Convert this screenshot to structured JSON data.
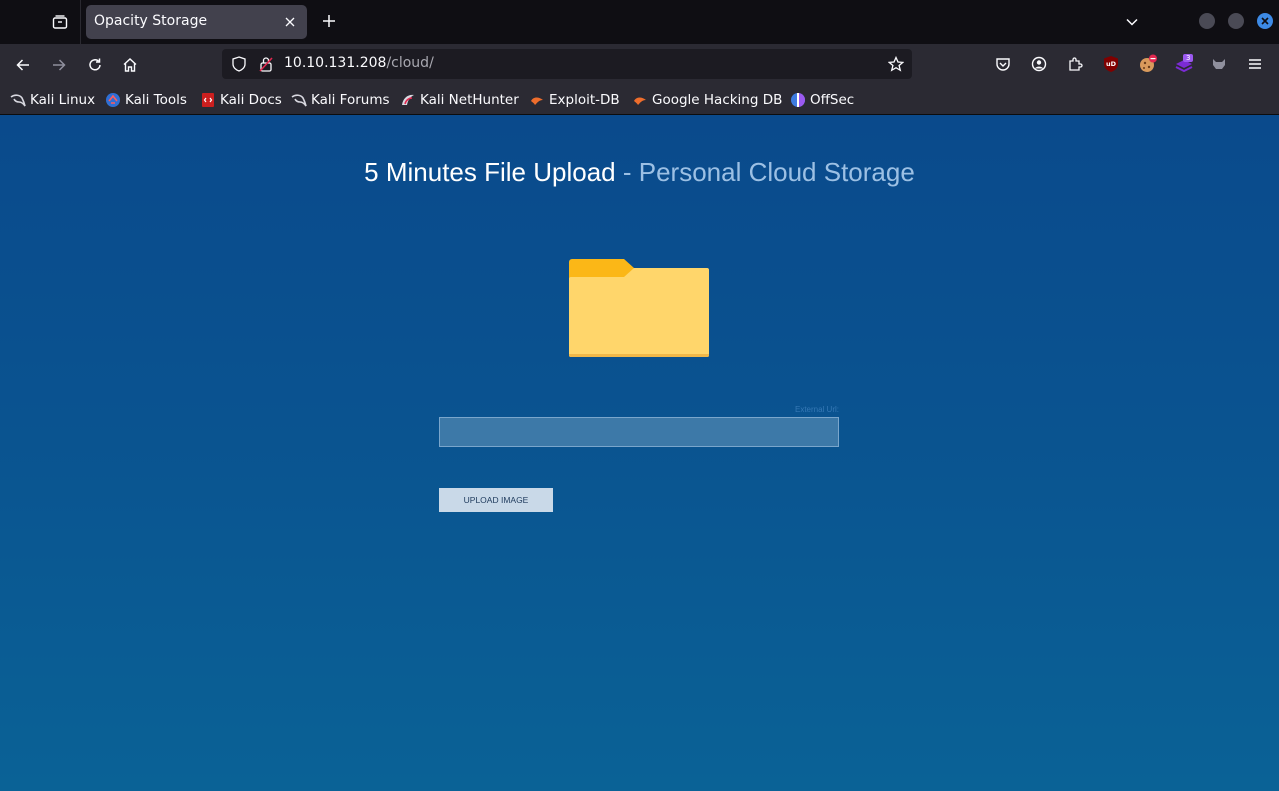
{
  "browser": {
    "tab": {
      "title": "Opacity Storage"
    },
    "address_bar": {
      "host": "10.10.131.208",
      "path": "/cloud/"
    },
    "extensions": {
      "ublock_label": "uD",
      "badge_count": "3"
    },
    "bookmarks": [
      {
        "label": "Kali Linux",
        "icon": "kali-dragon-icon"
      },
      {
        "label": "Kali Tools",
        "icon": "kali-tools-icon"
      },
      {
        "label": "Kali Docs",
        "icon": "kali-docs-icon"
      },
      {
        "label": "Kali Forums",
        "icon": "kali-dragon-icon"
      },
      {
        "label": "Kali NetHunter",
        "icon": "nethunter-icon"
      },
      {
        "label": "Exploit-DB",
        "icon": "exploit-db-icon"
      },
      {
        "label": "Google Hacking DB",
        "icon": "exploit-db-icon"
      },
      {
        "label": "OffSec",
        "icon": "offsec-icon"
      }
    ]
  },
  "page": {
    "title_main": "5 Minutes File Upload",
    "title_sub": " - Personal Cloud Storage",
    "external_url_label": "External Url:",
    "url_input_value": "",
    "upload_button_label": "Upload Image"
  },
  "colors": {
    "page_bg_top": "#0a4a8c",
    "page_bg_bottom": "#0a6296",
    "folder_yellow": "#ffd66b",
    "folder_tab": "#fbb717"
  }
}
